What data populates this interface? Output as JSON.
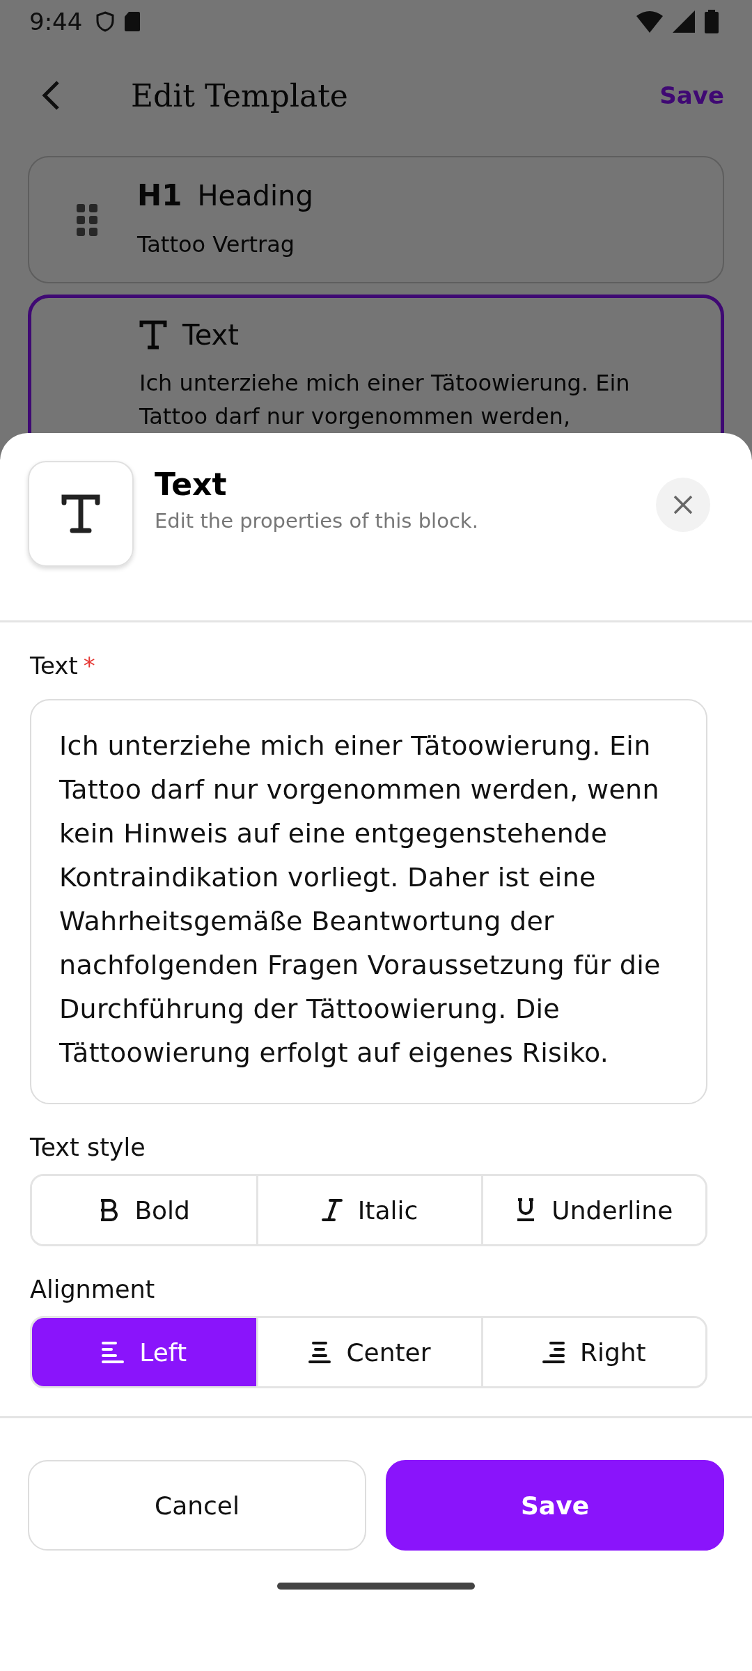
{
  "status_bar": {
    "time": "9:44"
  },
  "header": {
    "title": "Edit Template",
    "action": "Save"
  },
  "blocks": [
    {
      "kind": "heading",
      "icon_text": "H1",
      "type_label": "Heading",
      "text": "Tattoo Vertrag",
      "selected": false
    },
    {
      "kind": "text",
      "type_label": "Text",
      "text": "Ich unterziehe mich einer Tätoowierung. Ein Tattoo darf nur vorgenommen werden,",
      "selected": true
    }
  ],
  "sheet": {
    "title": "Text",
    "subtitle": "Edit the properties of this block."
  },
  "field": {
    "label": "Text",
    "required_mark": "*",
    "value": "Ich unterziehe mich einer Tätoowierung. Ein Tattoo darf nur vorgenommen werden, wenn kein Hinweis auf eine entgegenstehende Kontraindikation vorliegt. Daher ist eine Wahrheitsgemäße Beantwortung der nachfolgenden Fragen Voraussetzung für die Durchführung der Tättoowierung. Die Tättoowierung erfolgt auf eigenes Risiko."
  },
  "text_style": {
    "label": "Text style",
    "options": [
      {
        "kind": "bold",
        "label": "Bold",
        "selected": false
      },
      {
        "kind": "italic",
        "label": "Italic",
        "selected": false
      },
      {
        "kind": "underline",
        "label": "Underline",
        "selected": false
      }
    ]
  },
  "alignment": {
    "label": "Alignment",
    "options": [
      {
        "kind": "left",
        "label": "Left",
        "selected": true
      },
      {
        "kind": "center",
        "label": "Center",
        "selected": false
      },
      {
        "kind": "right",
        "label": "Right",
        "selected": false
      }
    ]
  },
  "buttons": [
    {
      "kind": "secondary",
      "label": "Cancel"
    },
    {
      "kind": "primary",
      "label": "Save"
    }
  ]
}
